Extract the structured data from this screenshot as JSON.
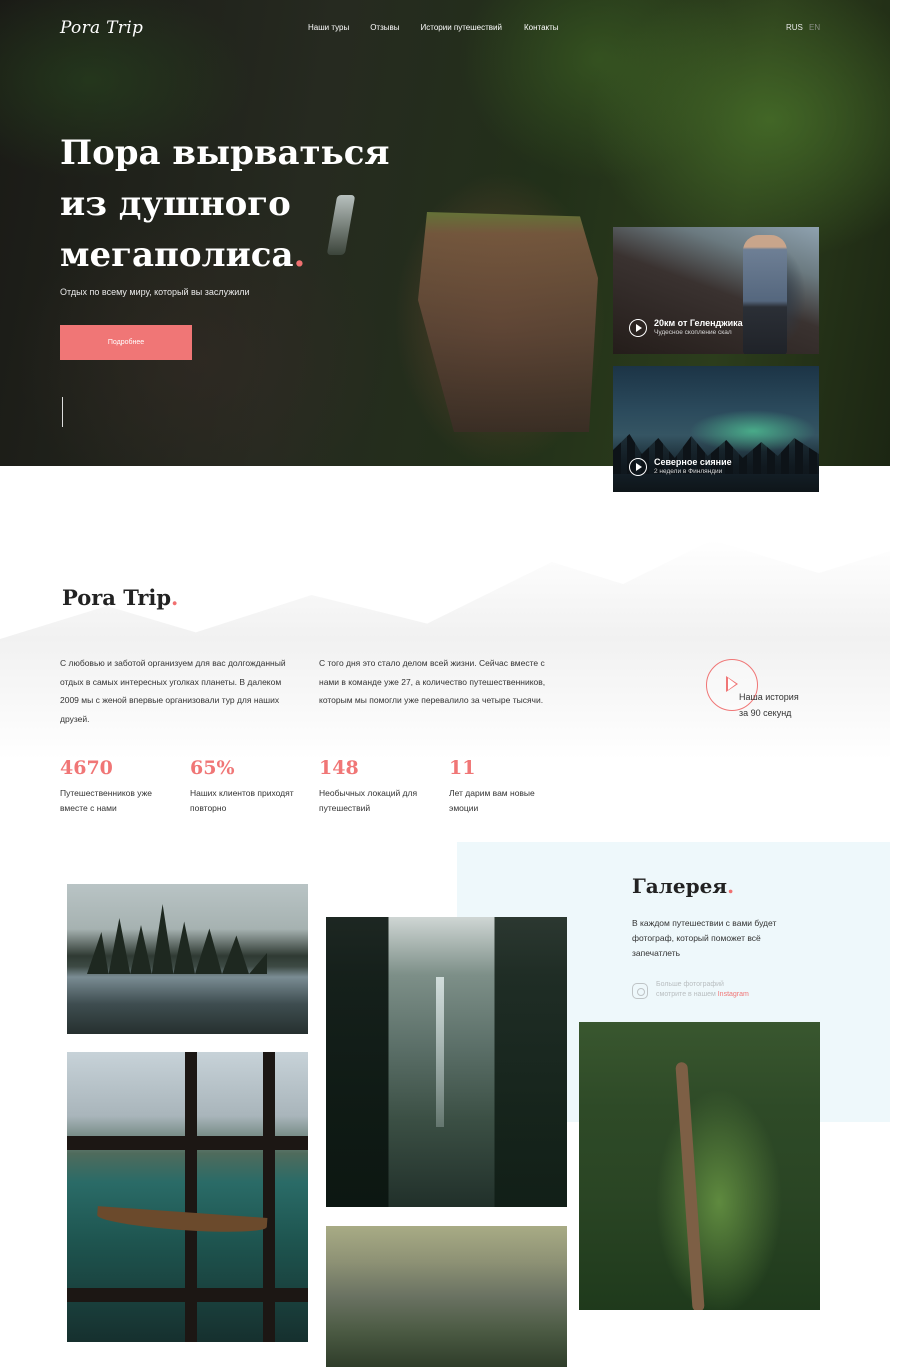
{
  "header": {
    "logo": "Pora Trip",
    "nav": [
      "Наши туры",
      "Отзывы",
      "Истории путешествий",
      "Контакты"
    ],
    "lang_active": "RUS",
    "lang_other": "EN"
  },
  "hero": {
    "title_line1": "Пора вырваться",
    "title_line2": "из душного",
    "title_line3": "мегаполиса",
    "title_dot": ".",
    "subtitle": "Отдых по всему миру, который вы заслужили",
    "button": "Подробнее"
  },
  "cards": [
    {
      "title": "20км от Геленджика",
      "desc": "Чудесное скопление скал"
    },
    {
      "title": "Северное сияние",
      "desc": "2 недели в Финляндии"
    }
  ],
  "about": {
    "title": "Pora Trip",
    "title_dot": ".",
    "text1": "С любовью и заботой организуем для вас долгожданный отдых в самых интересных уголках планеты. В далеком 2009 мы с женой впервые организовали тур для наших друзей.",
    "text2": "С того дня это стало делом всей жизни. Сейчас вместе с нами в команде уже 27, а количество путешественников, которым мы помогли уже перевалило за четыре тысячи.",
    "story_line1": "Наша история",
    "story_line2": "за 90 секунд"
  },
  "stats": [
    {
      "num": "4670",
      "label": "Путешественников уже вместе с нами"
    },
    {
      "num": "65%",
      "label": "Наших клиентов приходят повторно"
    },
    {
      "num": "148",
      "label": "Необычных локаций для путешествий"
    },
    {
      "num": "11",
      "label": "Лет дарим вам новые эмоции"
    }
  ],
  "gallery": {
    "title": "Галерея",
    "title_dot": ".",
    "desc": "В каждом путешествии с вами будет фотограф, который поможет всё запечатлеть",
    "insta_line1": "Больше фотографий",
    "insta_line2": "смотрите в нашем",
    "insta_link": "Instagram"
  },
  "colors": {
    "accent": "#f07676",
    "gallery_bg": "#eef8fb"
  }
}
